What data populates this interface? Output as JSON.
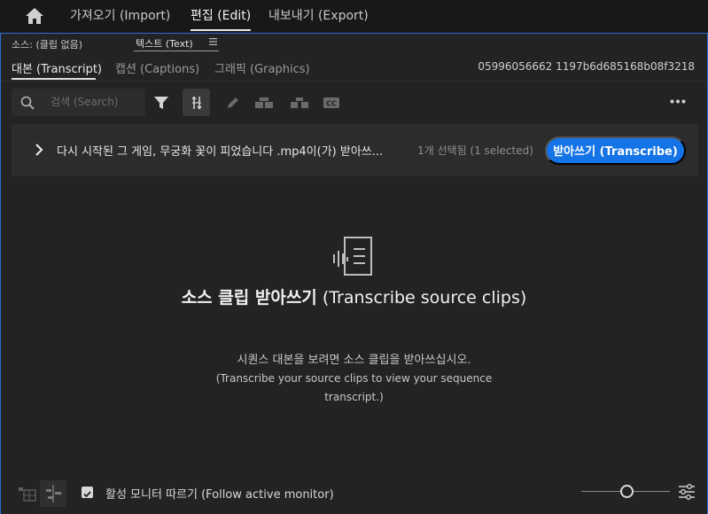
{
  "header": {
    "tabs": [
      {
        "label": "가져오기 (Import)"
      },
      {
        "label": "편집 (Edit)"
      },
      {
        "label": "내보내기 (Export)"
      }
    ]
  },
  "panel": {
    "source_label": "소스: (클립 없음)",
    "text_tab": "텍스트 (Text)",
    "subtabs": [
      {
        "label": "대본 (Transcript)"
      },
      {
        "label": "캡션 (Captions)"
      },
      {
        "label": "그래픽 (Graphics)"
      }
    ],
    "sequence_id": "05996056662 1197b6d685168b08f3218"
  },
  "toolbar": {
    "search_placeholder": "검색 (Search)"
  },
  "clip_row": {
    "name": "다시 시작된 그 게임, 무궁화 꽃이 피었습니다 .mp4이(가) 받아쓰...",
    "selected_count": "1개 선택됨 (1 selected)",
    "transcribe_button": "받아쓰기 (Transcribe)"
  },
  "empty_state": {
    "title_ko": "소스 클립 받아쓰기",
    "title_en": " (Transcribe source clips)",
    "desc_ko": "시퀀스 대본을 보려면 소스 클립을 받아쓰십시오.",
    "desc_en": "(Transcribe your source clips to view your sequence transcript.)"
  },
  "footer": {
    "follow_label": "활성 모니터 따르기 (Follow active monitor)",
    "follow_checked": true
  },
  "colors": {
    "accent": "#1473e6",
    "panel_border": "#2f6bdc"
  }
}
